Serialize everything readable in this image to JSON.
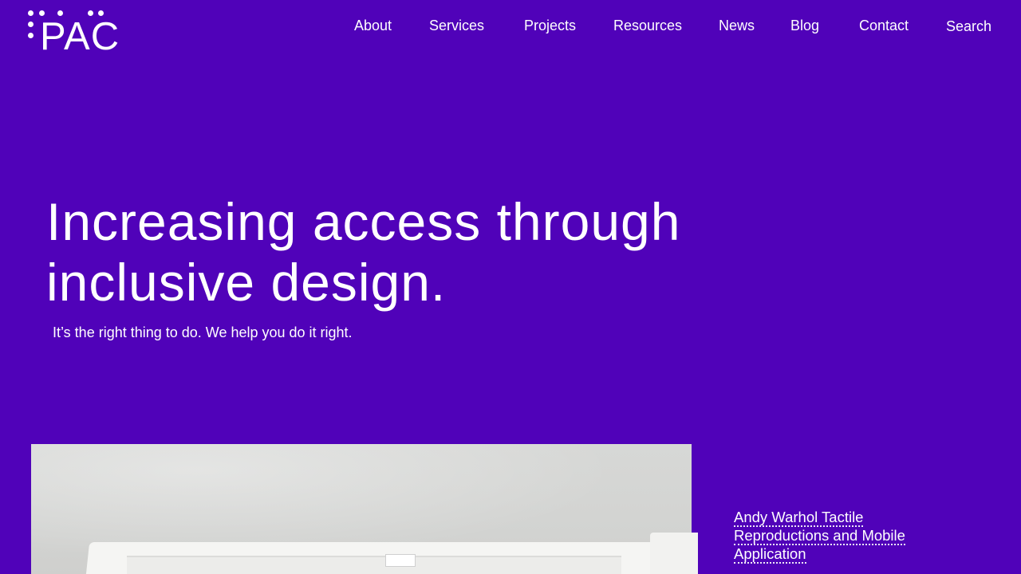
{
  "logo": {
    "text": "PAC"
  },
  "nav": {
    "items": [
      {
        "label": "About"
      },
      {
        "label": "Services"
      },
      {
        "label": "Projects"
      },
      {
        "label": "Resources"
      },
      {
        "label": "News"
      },
      {
        "label": "Blog"
      },
      {
        "label": "Contact"
      },
      {
        "label": "Search"
      }
    ]
  },
  "hero": {
    "title_line1": "Increasing access through",
    "title_line2": "inclusive design.",
    "subtitle": "It’s the right thing to do. We help you do it right."
  },
  "featured": {
    "link_text": "Andy Warhol Tactile Reproductions and Mobile Application"
  },
  "colors": {
    "background": "#5002b9",
    "text": "#ffffff"
  }
}
